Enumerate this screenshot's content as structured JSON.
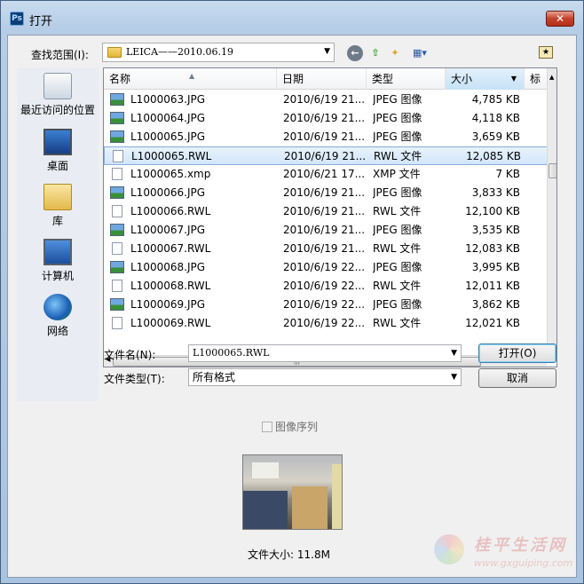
{
  "window": {
    "title": "打开",
    "app_icon_text": "Ps",
    "close_glyph": "✕"
  },
  "toolbar": {
    "lookin_label": "查找范围(I):",
    "lookin_value": "LEICA——2010.06.19",
    "back_glyph": "←",
    "up_glyph": "⇧",
    "newfolder_glyph": "✦",
    "view_glyph": "▦▾"
  },
  "places": [
    {
      "label": "最近访问的位置",
      "icon": "recent-places-icon"
    },
    {
      "label": "桌面",
      "icon": "desktop-icon"
    },
    {
      "label": "库",
      "icon": "libraries-icon"
    },
    {
      "label": "计算机",
      "icon": "computer-icon"
    },
    {
      "label": "网络",
      "icon": "network-icon"
    }
  ],
  "columns": {
    "name": "名称",
    "date": "日期",
    "type": "类型",
    "size": "大小",
    "tags": "标"
  },
  "files": [
    {
      "name": "L1000063.JPG",
      "date": "2010/6/19 21...",
      "type": "JPEG 图像",
      "size": "4,785 KB",
      "icon": "image"
    },
    {
      "name": "L1000064.JPG",
      "date": "2010/6/19 21...",
      "type": "JPEG 图像",
      "size": "4,118 KB",
      "icon": "image"
    },
    {
      "name": "L1000065.JPG",
      "date": "2010/6/19 21...",
      "type": "JPEG 图像",
      "size": "3,659 KB",
      "icon": "image"
    },
    {
      "name": "L1000065.RWL",
      "date": "2010/6/19 21...",
      "type": "RWL 文件",
      "size": "12,085 KB",
      "icon": "doc",
      "selected": true
    },
    {
      "name": "L1000065.xmp",
      "date": "2010/6/21 17...",
      "type": "XMP 文件",
      "size": "7 KB",
      "icon": "doc"
    },
    {
      "name": "L1000066.JPG",
      "date": "2010/6/19 21...",
      "type": "JPEG 图像",
      "size": "3,833 KB",
      "icon": "image"
    },
    {
      "name": "L1000066.RWL",
      "date": "2010/6/19 21...",
      "type": "RWL 文件",
      "size": "12,100 KB",
      "icon": "doc"
    },
    {
      "name": "L1000067.JPG",
      "date": "2010/6/19 21...",
      "type": "JPEG 图像",
      "size": "3,535 KB",
      "icon": "image"
    },
    {
      "name": "L1000067.RWL",
      "date": "2010/6/19 21...",
      "type": "RWL 文件",
      "size": "12,083 KB",
      "icon": "doc"
    },
    {
      "name": "L1000068.JPG",
      "date": "2010/6/19 22...",
      "type": "JPEG 图像",
      "size": "3,995 KB",
      "icon": "image"
    },
    {
      "name": "L1000068.RWL",
      "date": "2010/6/19 22...",
      "type": "RWL 文件",
      "size": "12,011 KB",
      "icon": "doc"
    },
    {
      "name": "L1000069.JPG",
      "date": "2010/6/19 22...",
      "type": "JPEG 图像",
      "size": "3,862 KB",
      "icon": "image"
    },
    {
      "name": "L1000069.RWL",
      "date": "2010/6/19 22...",
      "type": "RWL 文件",
      "size": "12,021 KB",
      "icon": "doc"
    }
  ],
  "form": {
    "filename_label": "文件名(N):",
    "filename_value": "L1000065.RWL",
    "filetype_label": "文件类型(T):",
    "filetype_value": "所有格式",
    "open_button": "打开(O)",
    "cancel_button": "取消",
    "image_sequence_label": "图像序列",
    "file_size_label": "文件大小: 11.8M"
  },
  "watermark": {
    "text": "桂平生活网",
    "url": "www.gxguiping.com"
  }
}
